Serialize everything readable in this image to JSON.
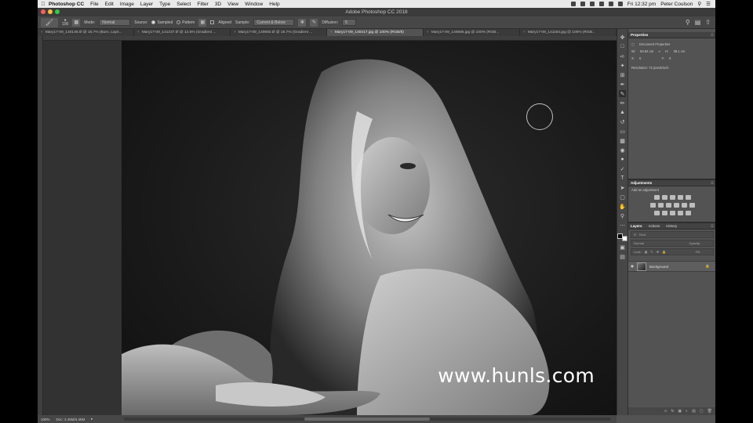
{
  "menubar": {
    "app_name": "Photoshop CC",
    "items": [
      "File",
      "Edit",
      "Image",
      "Layer",
      "Type",
      "Select",
      "Filter",
      "3D",
      "View",
      "Window",
      "Help"
    ],
    "clock": "Fri 12:32 pm",
    "user": "Peter Coulson"
  },
  "window": {
    "title": "Adobe Photoshop CC 2018"
  },
  "options": {
    "brush_size": "100",
    "mode_label": "Mode:",
    "mode_value": "Normal",
    "source_label": "Source:",
    "source_sampled": "Sampled",
    "source_pattern": "Pattern",
    "aligned_label": "Aligned",
    "sample_label": "Sample:",
    "sample_value": "Current & Below",
    "diffusion_label": "Diffusion:",
    "diffusion_value": "5"
  },
  "tabs": [
    {
      "label": "Mary17-09_140148.tif @ 16.7% (Burn, Lays..."
    },
    {
      "label": "Mary17-09_141237.tif @ 12.5% (Gradient ..."
    },
    {
      "label": "Mary17-09_140692.tif @ 16.7% (Gradient ..."
    },
    {
      "label": "Mary17-09_140417.jpg @ 100% (RGB/8)"
    },
    {
      "label": "Mary17-09_140686.jpg @ 100% (RGB..."
    },
    {
      "label": "Mary17-09_141184.jpg @ 100% (RGB..."
    }
  ],
  "active_tab_index": 3,
  "status": {
    "zoom": "100%",
    "doc": "Doc: 4.45M/4.45M"
  },
  "watermark": "www.hunls.com",
  "properties": {
    "title": "Properties",
    "section": "Document Properties",
    "w_label": "W:",
    "w_value": "50.84 cm",
    "h_label": "H:",
    "h_value": "38.1 cm",
    "x_label": "X:",
    "x_value": "0",
    "y_label": "Y:",
    "y_value": "0",
    "resolution": "Resolution: 72 pixels/inch"
  },
  "adjustments": {
    "title": "Adjustments",
    "subtitle": "Add an adjustment"
  },
  "layers": {
    "tabs": [
      "Layers",
      "Actions",
      "History"
    ],
    "kind_label": "Kind",
    "blend_label": "Normal",
    "opacity_label": "Opacity:",
    "lock_label": "Lock:",
    "fill_label": "Fill:",
    "layer_name": "Background"
  }
}
